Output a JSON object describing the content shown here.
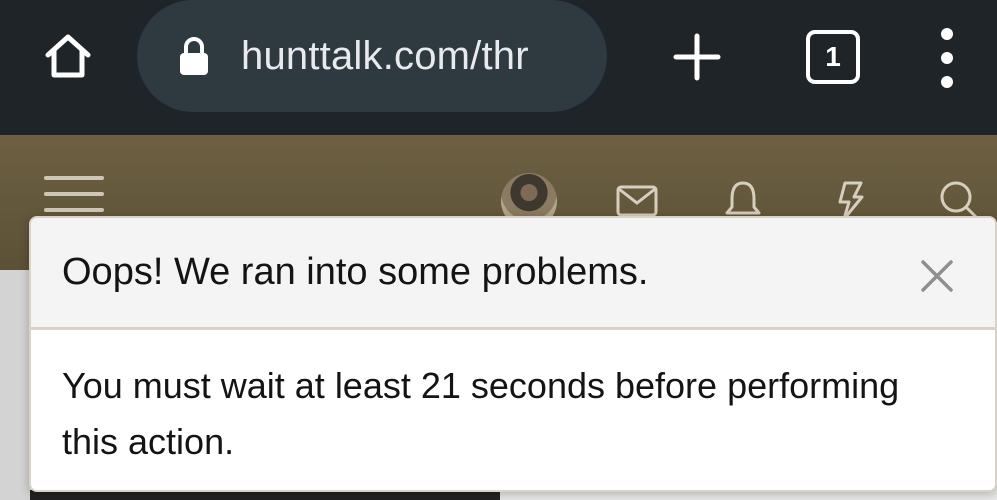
{
  "browser": {
    "url": "hunttalk.com/thr",
    "tab_count": "1",
    "icons": {
      "home": "home-icon",
      "lock": "lock-icon",
      "new_tab": "plus-icon",
      "menu": "more-vert-icon"
    }
  },
  "site_header": {
    "icons": [
      "menu-icon",
      "avatar",
      "envelope-icon",
      "bell-icon",
      "bolt-icon",
      "search-icon"
    ],
    "bg_color": "#6d6043"
  },
  "dialog": {
    "title": "Oops! We ran into some problems.",
    "message": "You must wait at least 21 seconds before performing this action.",
    "close_icon": "close-icon"
  }
}
